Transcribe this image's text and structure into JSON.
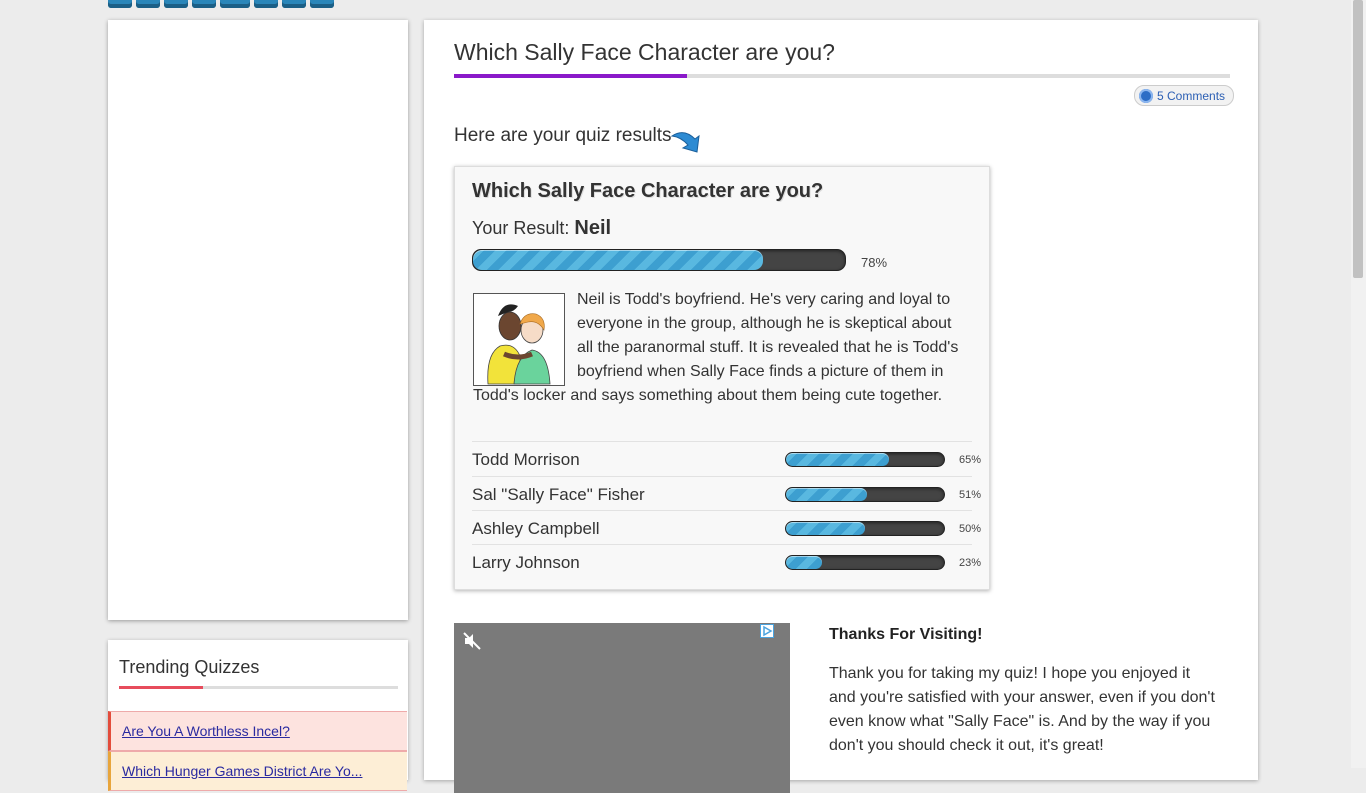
{
  "page": {
    "title": "Which Sally Face Character are you?",
    "comments_label": "5 Comments",
    "results_heading": "Here are your quiz results"
  },
  "result": {
    "title": "Which Sally Face Character are you?",
    "result_prefix": "Your Result:",
    "result_name": "Neil",
    "percent": 78,
    "percent_label": "78%",
    "description": "Neil is Todd's boyfriend. He's very caring and loyal to everyone in the group, although he is skeptical about all the paranormal stuff. It is revealed that he is Todd's boyfriend when Sally Face finds a picture of them in Todd's locker and says something about them being cute together.",
    "others": [
      {
        "name": "Todd Morrison",
        "percent": 65,
        "label": "65%"
      },
      {
        "name": "Sal \"Sally Face\" Fisher",
        "percent": 51,
        "label": "51%"
      },
      {
        "name": "Ashley Campbell",
        "percent": 50,
        "label": "50%"
      },
      {
        "name": "Larry Johnson",
        "percent": 23,
        "label": "23%"
      }
    ]
  },
  "thanks": {
    "title": "Thanks For Visiting!",
    "text": "Thank you for taking my quiz! I hope you enjoyed it and you're satisfied with your answer, even if you don't even know what \"Sally Face\" is. And by the way if you don't you should check it out, it's great!"
  },
  "trending": {
    "title": "Trending Quizzes",
    "items": [
      {
        "label": "Are You A Worthless Incel?"
      },
      {
        "label": "Which Hunger Games District Are Yo..."
      }
    ]
  },
  "icons": {
    "comment": "speech-bubble-icon",
    "arrow": "curved-arrow-down-icon",
    "mute": "muted-speaker-icon",
    "adchoices": "adchoices-icon"
  },
  "colors": {
    "title_accent": "#8a19c9",
    "trending_accent": "#e74c5c",
    "progress_fill": "#4aaed9",
    "link": "#2a2aa0"
  }
}
